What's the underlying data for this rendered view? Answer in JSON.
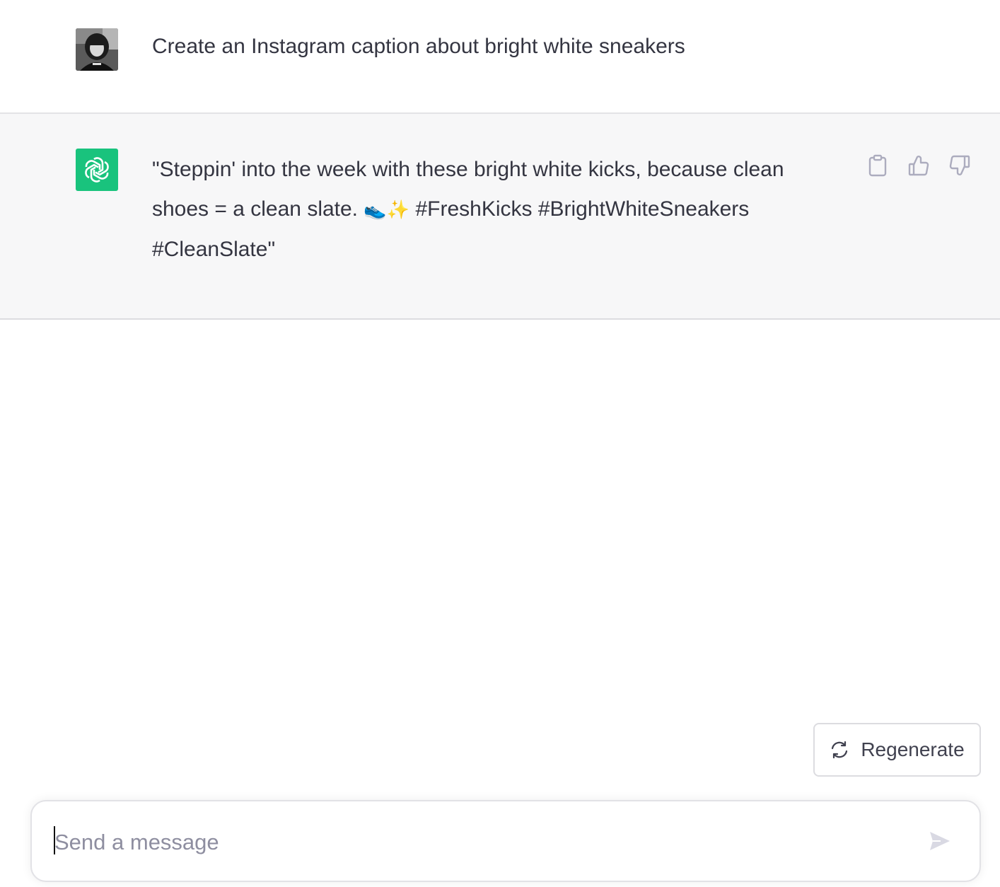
{
  "conversation": {
    "user_message": "Create an Instagram caption about bright white sneakers",
    "assistant_message": {
      "line1": "\"Steppin' into the week with these bright white kicks, because clean",
      "line2_pre": "shoes = a clean slate. ",
      "emoji1": "👟",
      "emoji2": "✨",
      "line2_post": " #FreshKicks #BrightWhiteSneakers",
      "line3": "#CleanSlate\""
    },
    "actions": {
      "copy_icon": "clipboard-icon",
      "like_icon": "thumbs-up-icon",
      "dislike_icon": "thumbs-down-icon"
    }
  },
  "regenerate": {
    "label": "Regenerate",
    "icon": "refresh-icon"
  },
  "composer": {
    "placeholder": "Send a message",
    "value": "",
    "send_icon": "paper-plane-icon"
  },
  "colors": {
    "bot_avatar_bg": "#19c37d",
    "assistant_row_bg": "#f7f7f8",
    "text": "#343541",
    "icon_gray": "#acacbe"
  }
}
